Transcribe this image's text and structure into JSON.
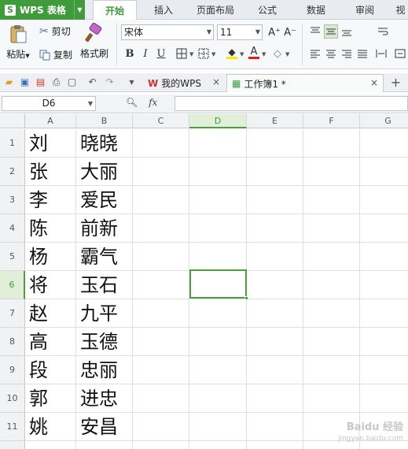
{
  "app": {
    "name": "WPS 表格"
  },
  "menu": [
    {
      "label": "开始",
      "active": true
    },
    {
      "label": "插入"
    },
    {
      "label": "页面布局"
    },
    {
      "label": "公式"
    },
    {
      "label": "数据"
    },
    {
      "label": "审阅"
    },
    {
      "label": "视"
    }
  ],
  "ribbon": {
    "paste": "粘贴",
    "cut": "剪切",
    "copy": "复制",
    "format_painter": "格式刷",
    "font_name": "宋体",
    "font_size": "11",
    "bold": "B",
    "italic": "I",
    "underline": "U",
    "grow": "A⁺",
    "shrink": "A⁻",
    "font_color_glyph": "A"
  },
  "tabs": [
    {
      "label": "我的WPS"
    },
    {
      "label": "工作簿1 *",
      "active": true
    }
  ],
  "formula": {
    "cell_ref": "D6",
    "fx": "fx",
    "value": ""
  },
  "columns": [
    "A",
    "B",
    "C",
    "D",
    "E",
    "F",
    "G"
  ],
  "selected_column": "D",
  "selected_row": "6",
  "rows": [
    {
      "num": "1",
      "a": "刘",
      "b": "晓晓"
    },
    {
      "num": "2",
      "a": "张",
      "b": "大丽"
    },
    {
      "num": "3",
      "a": "李",
      "b": "爱民"
    },
    {
      "num": "4",
      "a": "陈",
      "b": "前新"
    },
    {
      "num": "5",
      "a": "杨",
      "b": "霸气"
    },
    {
      "num": "6",
      "a": "将",
      "b": "玉石"
    },
    {
      "num": "7",
      "a": "赵",
      "b": "九平"
    },
    {
      "num": "8",
      "a": "高",
      "b": "玉德"
    },
    {
      "num": "9",
      "a": "段",
      "b": "忠丽"
    },
    {
      "num": "10",
      "a": "郭",
      "b": "进忠"
    },
    {
      "num": "11",
      "a": "姚",
      "b": "安昌"
    }
  ],
  "watermark": {
    "text": "Baidu 经验",
    "sub": "jingyan.baidu.com"
  },
  "colors": {
    "accent": "#3f9b3c",
    "selection": "#4e9e3f"
  }
}
